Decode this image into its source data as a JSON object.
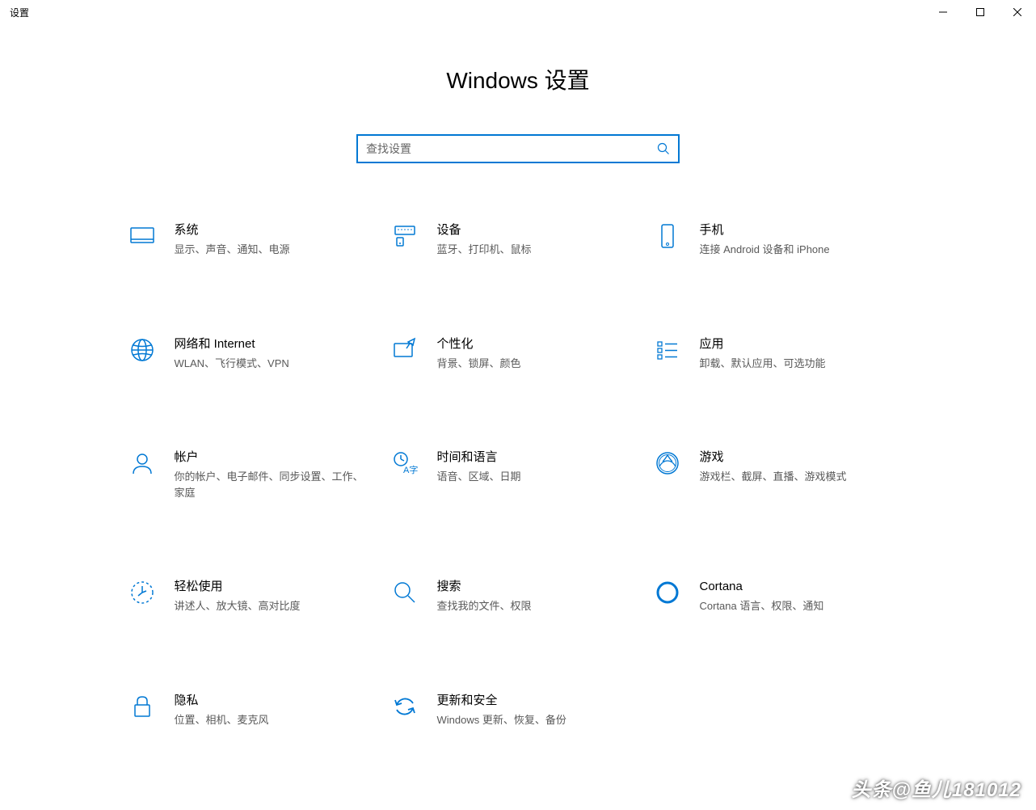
{
  "window": {
    "title": "设置"
  },
  "header": {
    "title": "Windows 设置"
  },
  "search": {
    "placeholder": "查找设置"
  },
  "categories": [
    {
      "id": "system",
      "title": "系统",
      "desc": "显示、声音、通知、电源"
    },
    {
      "id": "devices",
      "title": "设备",
      "desc": "蓝牙、打印机、鼠标"
    },
    {
      "id": "phone",
      "title": "手机",
      "desc": "连接 Android 设备和 iPhone"
    },
    {
      "id": "network",
      "title": "网络和 Internet",
      "desc": "WLAN、飞行模式、VPN"
    },
    {
      "id": "personalization",
      "title": "个性化",
      "desc": "背景、锁屏、颜色"
    },
    {
      "id": "apps",
      "title": "应用",
      "desc": "卸载、默认应用、可选功能"
    },
    {
      "id": "accounts",
      "title": "帐户",
      "desc": "你的帐户、电子邮件、同步设置、工作、家庭"
    },
    {
      "id": "time-language",
      "title": "时间和语言",
      "desc": "语音、区域、日期"
    },
    {
      "id": "gaming",
      "title": "游戏",
      "desc": "游戏栏、截屏、直播、游戏模式"
    },
    {
      "id": "ease-of-access",
      "title": "轻松使用",
      "desc": "讲述人、放大镜、高对比度"
    },
    {
      "id": "search-category",
      "title": "搜索",
      "desc": "查找我的文件、权限"
    },
    {
      "id": "cortana",
      "title": "Cortana",
      "desc": "Cortana 语言、权限、通知"
    },
    {
      "id": "privacy",
      "title": "隐私",
      "desc": "位置、相机、麦克风"
    },
    {
      "id": "update-security",
      "title": "更新和安全",
      "desc": "Windows 更新、恢复、备份"
    }
  ],
  "watermark": "头条@鱼儿181012",
  "colors": {
    "accent": "#0078d4",
    "iconBlue": "#0078d4"
  }
}
